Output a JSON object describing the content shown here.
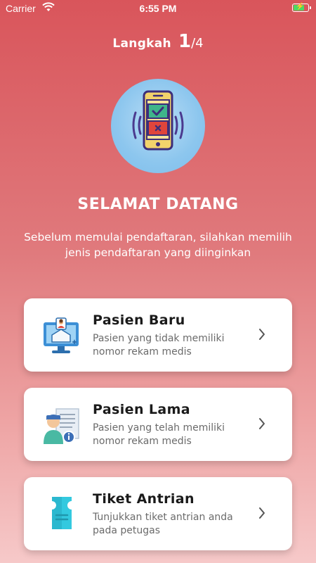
{
  "status_bar": {
    "carrier": "Carrier",
    "time": "6:55 PM"
  },
  "step": {
    "label": "Langkah",
    "current": "1",
    "total": "/4"
  },
  "welcome": {
    "title": "SELAMAT DATANG",
    "subtitle": "Sebelum memulai pendaftaran, silahkan memilih jenis pendaftaran yang diinginkan"
  },
  "options": [
    {
      "title": "Pasien Baru",
      "description": "Pasien yang tidak memiliki nomor rekam medis",
      "icon": "new-patient-icon"
    },
    {
      "title": "Pasien Lama",
      "description": "Pasien yang telah memiliki nomor rekam medis",
      "icon": "existing-patient-icon"
    },
    {
      "title": "Tiket Antrian",
      "description": "Tunjukkan tiket antrian anda pada petugas",
      "icon": "ticket-icon"
    }
  ],
  "colors": {
    "gradient_top": "#d9555b",
    "gradient_bottom": "#f6c9c9",
    "card_bg": "#ffffff",
    "icon_circle": "#8cc6ee"
  }
}
